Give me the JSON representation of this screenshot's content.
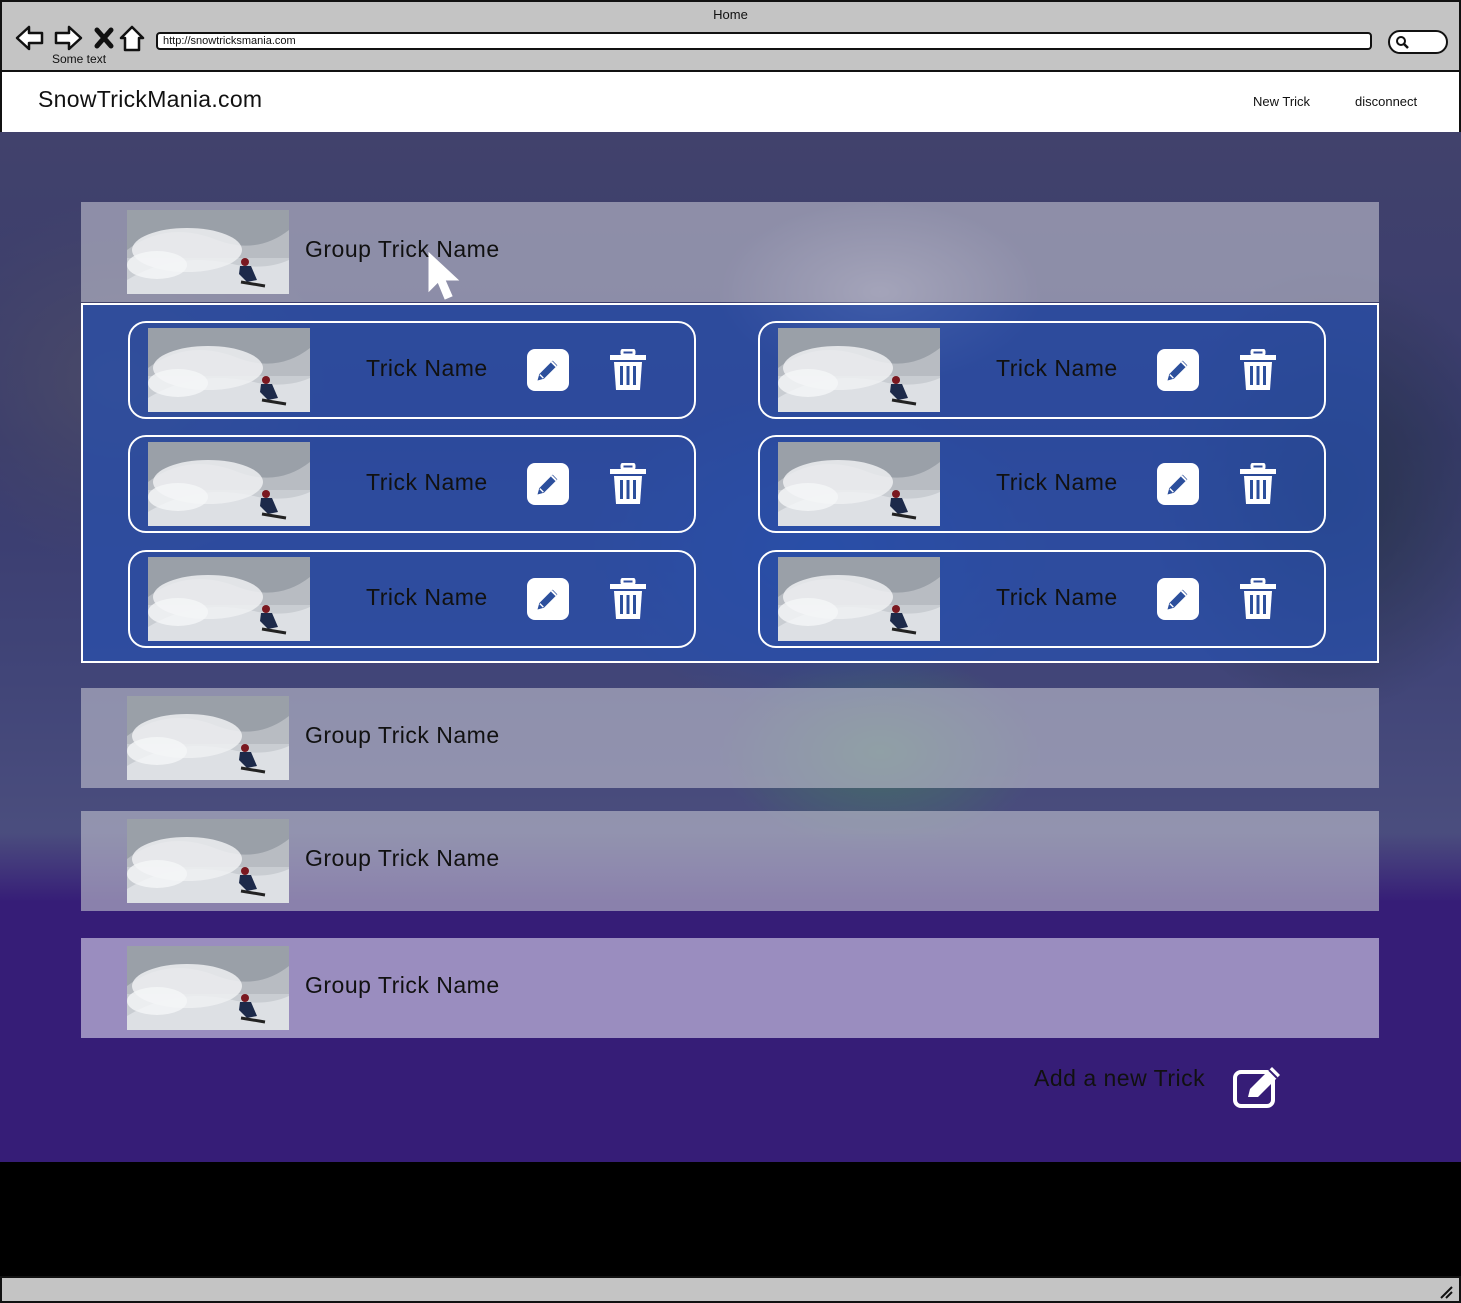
{
  "browser": {
    "window_title": "Home",
    "url": "http://snowtricksmania.com",
    "status_text": "Some text"
  },
  "header": {
    "brand": "SnowTrickMania.com",
    "nav": {
      "new_trick": "New Trick",
      "disconnect": "disconnect"
    }
  },
  "groups": [
    {
      "title": "Group Trick Name",
      "expanded": true,
      "tricks": [
        {
          "name": "Trick Name"
        },
        {
          "name": "Trick Name"
        },
        {
          "name": "Trick Name"
        },
        {
          "name": "Trick Name"
        },
        {
          "name": "Trick Name"
        },
        {
          "name": "Trick Name"
        }
      ]
    },
    {
      "title": "Group Trick Name",
      "expanded": false
    },
    {
      "title": "Group Trick Name",
      "expanded": false
    },
    {
      "title": "Group Trick Name",
      "expanded": false
    }
  ],
  "actions": {
    "add_trick_label": "Add a new Trick"
  },
  "icons": {
    "back": "arrow-left-icon",
    "forward": "arrow-right-icon",
    "stop": "close-icon",
    "home": "home-icon",
    "search": "search-icon",
    "edit": "pencil-icon",
    "delete": "trash-icon",
    "add": "edit-square-icon"
  },
  "colors": {
    "page_purple": "#361d77",
    "panel_blue": "#2850af",
    "chrome_gray": "#c4c4c4",
    "footer": "#000000"
  }
}
